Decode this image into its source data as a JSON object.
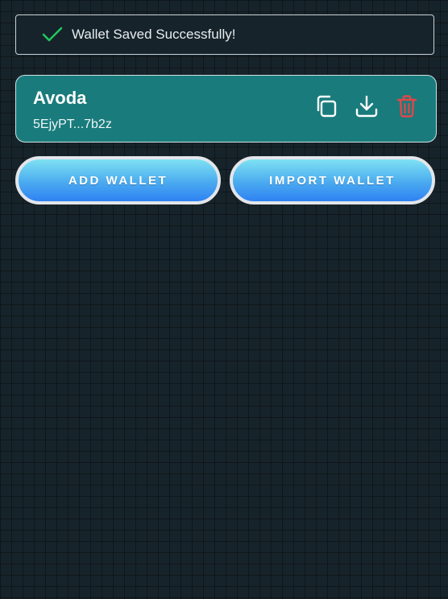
{
  "toast": {
    "message": "Wallet Saved Successfully!",
    "icon": "check-icon",
    "icon_color": "#22c55e"
  },
  "wallet": {
    "name": "Avoda",
    "address": "5EjyPT...7b2z",
    "actions": [
      {
        "name": "copy",
        "icon": "copy-icon"
      },
      {
        "name": "download",
        "icon": "download-icon"
      },
      {
        "name": "delete",
        "icon": "trash-icon",
        "color": "#e04848"
      }
    ]
  },
  "buttons": {
    "add_label": "ADD WALLET",
    "import_label": "IMPORT WALLET"
  }
}
